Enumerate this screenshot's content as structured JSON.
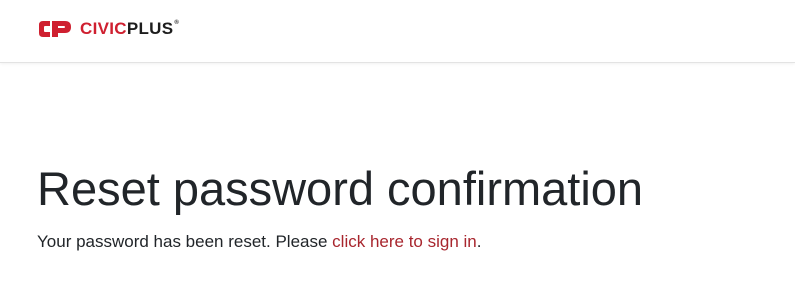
{
  "header": {
    "logo": {
      "icon": "civicplus-logo-mark",
      "text_part1": "CIVIC",
      "text_part2": "PLUS",
      "trademark": "®"
    }
  },
  "main": {
    "title": "Reset password confirmation",
    "message_prefix": "Your password has been reset. Please ",
    "link_text": "click here to sign in",
    "message_suffix": "."
  },
  "colors": {
    "brand_red": "#cf2030",
    "link": "#a8262e",
    "text": "#212529"
  }
}
